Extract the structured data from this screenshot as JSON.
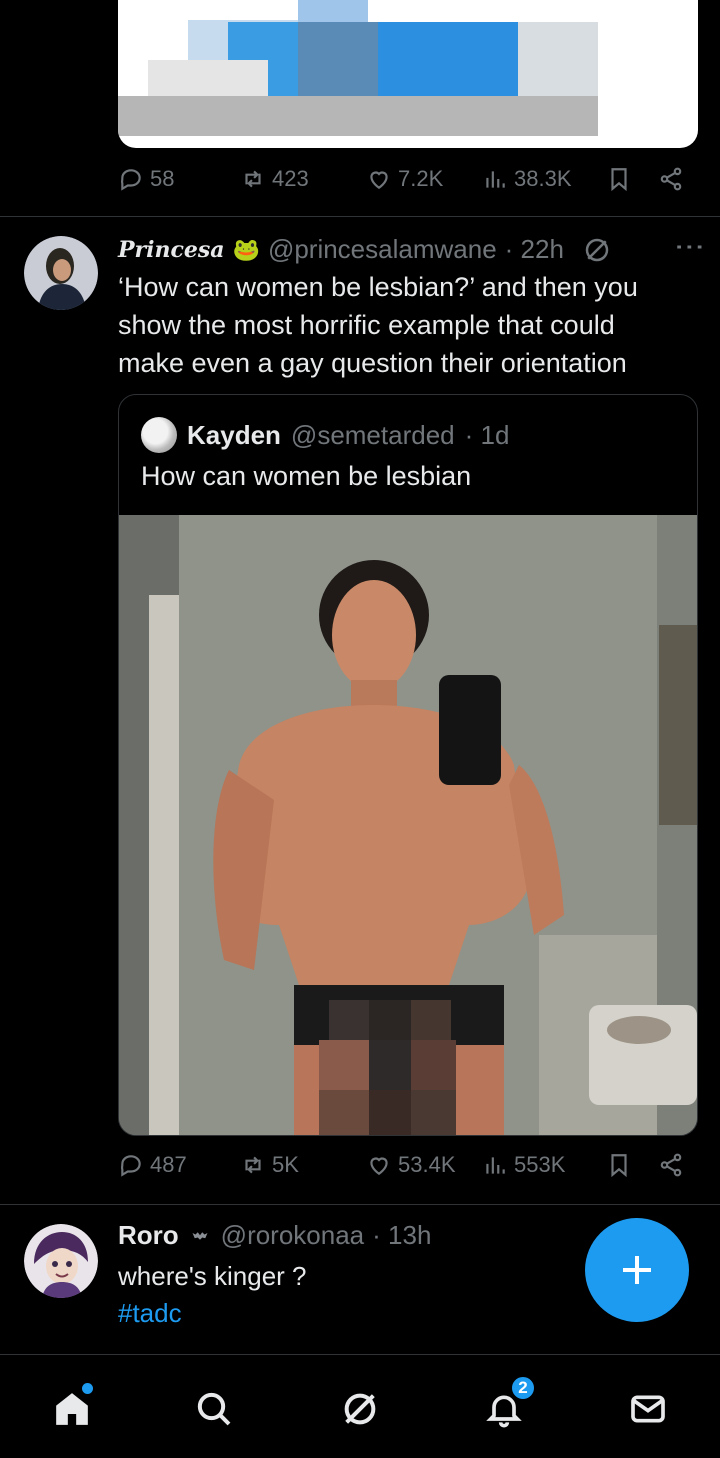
{
  "previous_tweet": {
    "actions": {
      "replies": "58",
      "reposts": "423",
      "likes": "7.2K",
      "views": "38.3K"
    }
  },
  "main_tweet": {
    "display_name": "Princesa",
    "handle": "@princesalamwane",
    "time": "· 22h",
    "text": "‘How can women be lesbian?’ and then you show the most horrific example that could make even a gay question their orientation",
    "quote": {
      "display_name": "Kayden",
      "handle": "@semetarded",
      "time": "· 1d",
      "text": "How can women be lesbian"
    },
    "actions": {
      "replies": "487",
      "reposts": "5K",
      "likes": "53.4K",
      "views": "553K"
    }
  },
  "third_tweet": {
    "display_name": "Roro",
    "handle": "@rorokonaa",
    "time": "· 13h",
    "text": "where's kinger ?",
    "hashtag": "#tadc"
  },
  "bottom_nav": {
    "notifications_badge": "2"
  },
  "colors": {
    "background": "#000000",
    "accent": "#1d9bf0",
    "muted": "#71767b",
    "text": "#e7e9ea"
  }
}
